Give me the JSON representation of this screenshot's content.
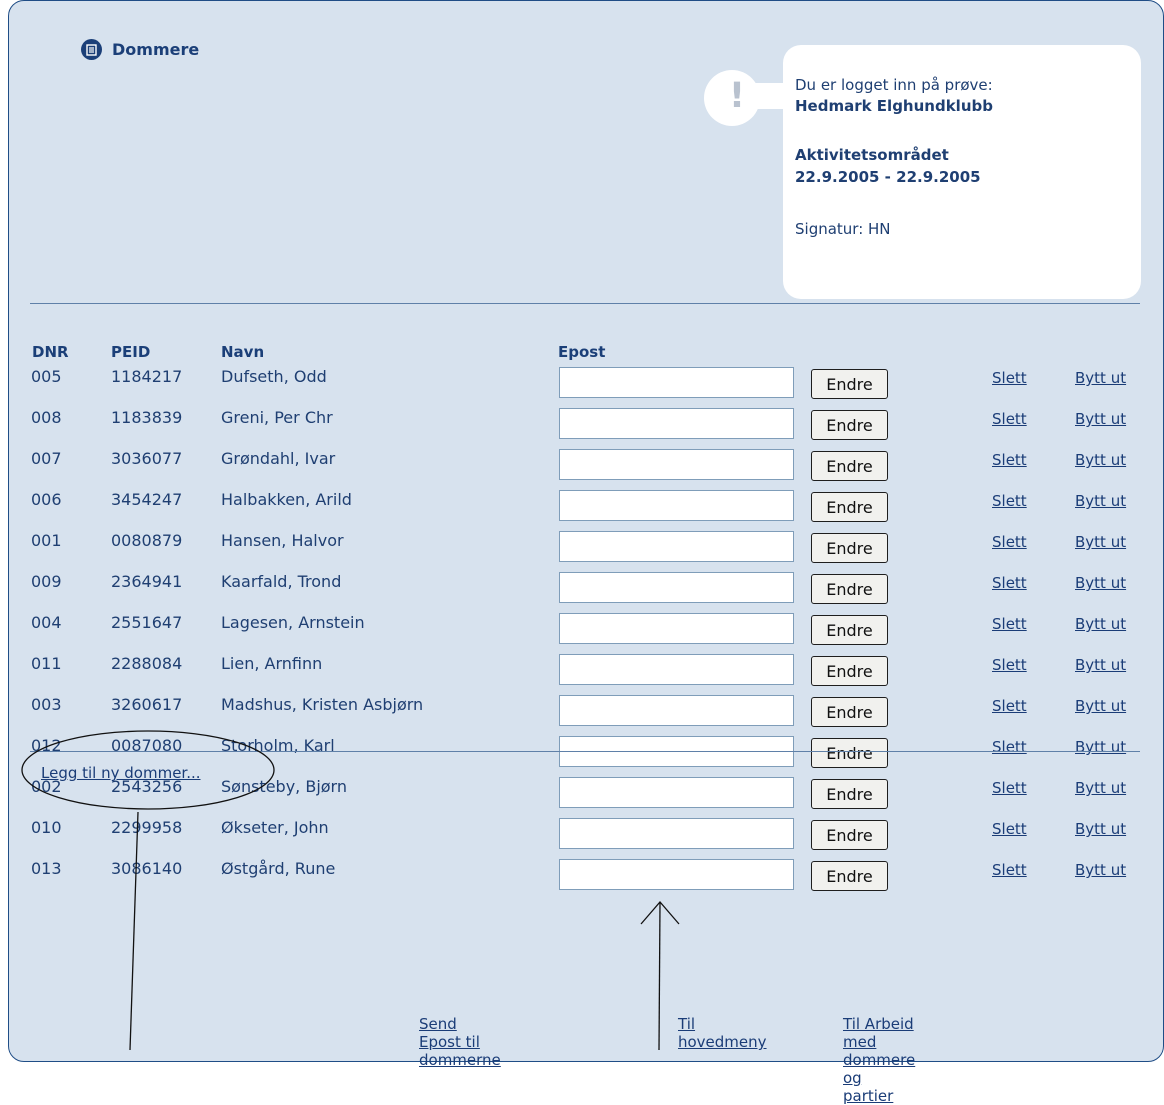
{
  "page": {
    "title": "Dommere"
  },
  "info": {
    "intro": "Du er logget inn på prøve:",
    "club": "Hedmark Elghundklubb",
    "area": "Aktivitetsområdet",
    "dates": "22.9.2005 - 22.9.2005",
    "signature": "Signatur: HN"
  },
  "table": {
    "headers": {
      "dnr": "DNR",
      "peid": "PEID",
      "name": "Navn",
      "email": "Epost"
    },
    "button_label": "Endre",
    "delete_label": "Slett",
    "replace_label": "Bytt ut",
    "rows": [
      {
        "dnr": "005",
        "peid": "1184217",
        "name": "Dufseth, Odd",
        "email": ""
      },
      {
        "dnr": "008",
        "peid": "1183839",
        "name": "Greni, Per Chr",
        "email": ""
      },
      {
        "dnr": "007",
        "peid": "3036077",
        "name": "Grøndahl, Ivar",
        "email": ""
      },
      {
        "dnr": "006",
        "peid": "3454247",
        "name": "Halbakken, Arild",
        "email": ""
      },
      {
        "dnr": "001",
        "peid": "0080879",
        "name": "Hansen, Halvor",
        "email": ""
      },
      {
        "dnr": "009",
        "peid": "2364941",
        "name": "Kaarfald, Trond",
        "email": ""
      },
      {
        "dnr": "004",
        "peid": "2551647",
        "name": "Lagesen, Arnstein",
        "email": ""
      },
      {
        "dnr": "011",
        "peid": "2288084",
        "name": "Lien, Arnfinn",
        "email": ""
      },
      {
        "dnr": "003",
        "peid": "3260617",
        "name": "Madshus, Kristen Asbjørn",
        "email": ""
      },
      {
        "dnr": "012",
        "peid": "0087080",
        "name": "Storholm, Karl",
        "email": ""
      },
      {
        "dnr": "002",
        "peid": "2543256",
        "name": "Sønsteby, Bjørn",
        "email": ""
      },
      {
        "dnr": "010",
        "peid": "2299958",
        "name": "Økseter, John",
        "email": ""
      },
      {
        "dnr": "013",
        "peid": "3086140",
        "name": "Østgård, Rune",
        "email": ""
      }
    ]
  },
  "links": {
    "add_judge": "Legg til ny dommer...",
    "send_email": "Send Epost til dommerne",
    "main_menu": "Til hovedmeny",
    "work_with": "Til Arbeid med dommere og partier"
  }
}
